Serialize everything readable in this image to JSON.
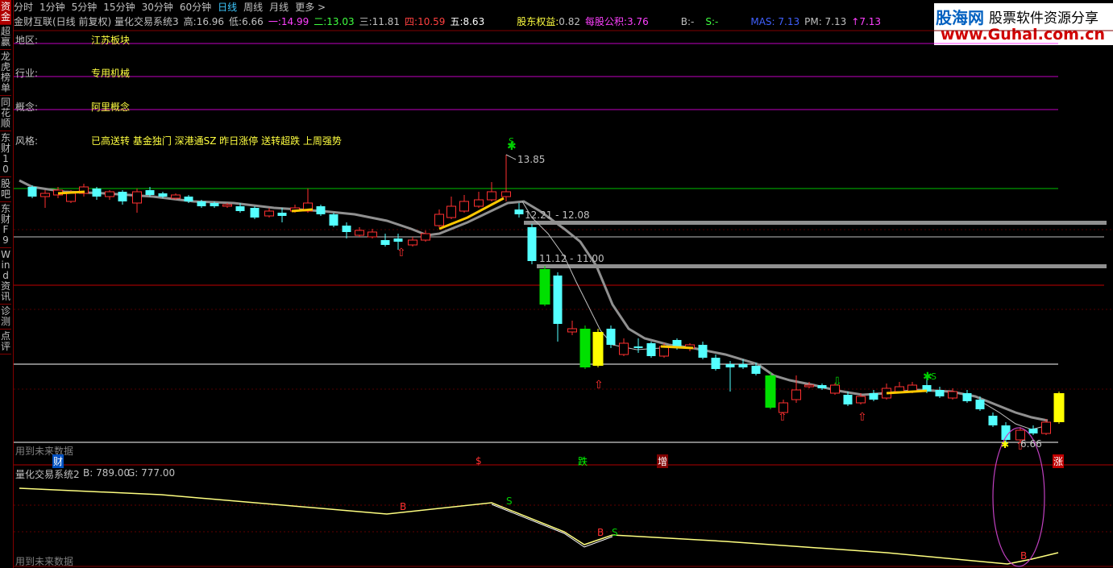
{
  "sidebar": {
    "items": [
      "资金",
      "超赢",
      "龙虎榜单",
      "同花顺",
      "东财10",
      "股吧",
      "东财F9",
      "Wind资讯",
      "诊测",
      "点评"
    ]
  },
  "periods": {
    "items": [
      "分时",
      "1分钟",
      "5分钟",
      "15分钟",
      "30分钟",
      "60分钟",
      "日线",
      "周线",
      "月线",
      "更多 >"
    ],
    "active": "日线"
  },
  "info": {
    "title": "金财互联(日线 前复权) 量化交易系统3",
    "high_label": "高:",
    "high": "16.96",
    "low_label": "低:",
    "low": "6.66",
    "l1": "一:14.99",
    "l2": "二:13.03",
    "l3": "三:11.81",
    "l4": "四:10.59",
    "l5": "五:8.63",
    "equity_label": "股东权益:",
    "equity": "0.82",
    "reserve_label": "每股公积:",
    "reserve": "3.76",
    "b": "B:-",
    "s": "S:-",
    "mas": "MAS: 7.13",
    "pm": "PM: 7.13",
    "arrow": "↑7.13"
  },
  "logo": {
    "line1": "股海网",
    "line2": "股票软件资源分享",
    "line3": "www.Guhai.com.cn"
  },
  "meta": {
    "region_label": "地区:",
    "region": "江苏板块",
    "industry_label": "行业:",
    "industry": "专用机械",
    "concept_label": "概念:",
    "concept": "阿里概念",
    "style_label": "风格:",
    "style": "已高送转 基金独门 深港通SZ 昨日涨停 送转超跌 上周强势"
  },
  "annotations": {
    "peak": "13.85",
    "range1": "12.21 - 12.08",
    "range2": "11.12 - 11.00",
    "low": "6.66",
    "future1": "用到未来数据",
    "future2": "用到未来数据",
    "marks": {
      "cai": "财",
      "s": "$",
      "die": "跌",
      "zeng": "增",
      "zhang": "涨"
    },
    "peak_s": "S",
    "right_s": "S"
  },
  "sub": {
    "title": "量化交易系统2",
    "b": "B: 789.00",
    "g": "G: 777.00",
    "b_mark": "B",
    "s_mark": "S"
  },
  "colors": {
    "up": "#ff3030",
    "down": "#54ffff",
    "ma": "#808080",
    "yellow": "#ffff00",
    "green": "#00ff00",
    "magenta": "#ff40ff"
  }
}
